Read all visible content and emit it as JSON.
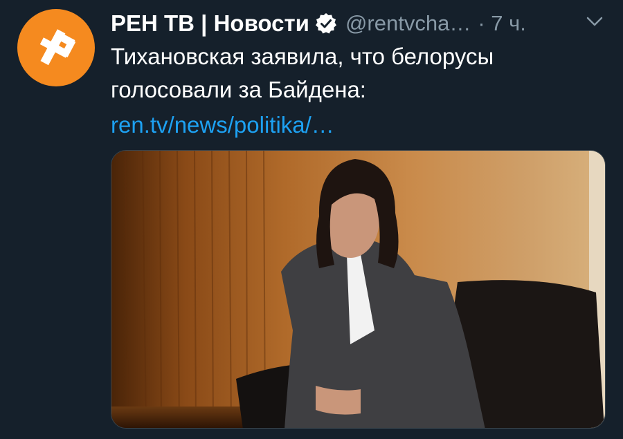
{
  "tweet": {
    "display_name": "РЕН ТВ | Новости",
    "handle": "@rentvcha…",
    "time": "· 7 ч.",
    "text": "Тихановская заявила, что белорусы голосовали за Байдена:",
    "link": "ren.tv/news/politika/…"
  },
  "icons": {
    "avatar": "ren-tv-logo",
    "verified": "verified-badge-icon",
    "menu": "chevron-down-icon"
  },
  "colors": {
    "background": "#15202b",
    "avatar_orange": "#f58a1f",
    "link_blue": "#1da1f2",
    "secondary_gray": "#8899a6"
  }
}
